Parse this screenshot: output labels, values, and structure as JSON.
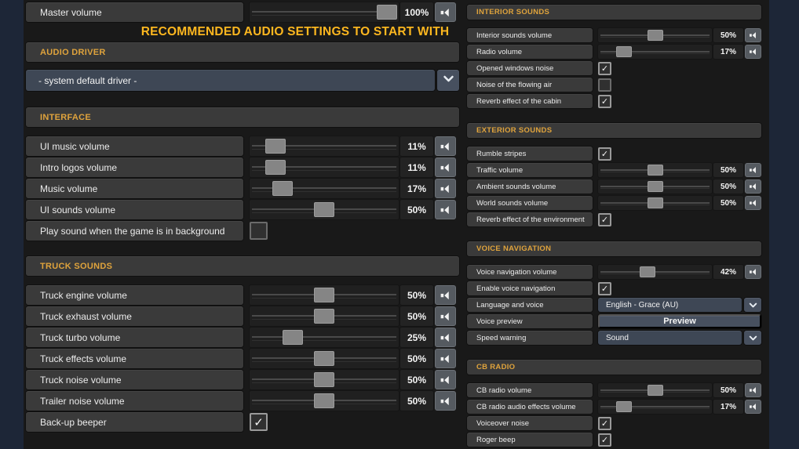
{
  "title": "RECOMMENDED AUDIO SETTINGS TO START WITH",
  "colors": {
    "accent_orange": "#dfa33c",
    "title_yellow": "#fdb71f",
    "panel_bg": "#191919",
    "side_strip": "#1d2637",
    "box_bg": "#3a3a3a",
    "dropdown_bg": "#3e4755",
    "slider_handle": "#858585"
  },
  "icons": {
    "mute": "speaker-icon",
    "dropdown": "chevron-down-icon",
    "checkmark": "✓"
  },
  "left": {
    "master_rows": [
      {
        "label": "Master volume",
        "type": "slider",
        "value": "100%",
        "percent": 100
      }
    ],
    "audio_driver": {
      "header": "AUDIO DRIVER",
      "selected": "- system default driver -"
    },
    "interface": {
      "header": "INTERFACE",
      "rows": [
        {
          "label": "UI music volume",
          "type": "slider",
          "value": "11%",
          "percent": 11
        },
        {
          "label": "Intro logos volume",
          "type": "slider",
          "value": "11%",
          "percent": 11
        },
        {
          "label": "Music volume",
          "type": "slider",
          "value": "17%",
          "percent": 17
        },
        {
          "label": "UI sounds volume",
          "type": "slider",
          "value": "50%",
          "percent": 50
        },
        {
          "label": "Play sound when the game is in background",
          "type": "checkbox",
          "checked": false
        }
      ]
    },
    "truck_sounds": {
      "header": "TRUCK SOUNDS",
      "rows": [
        {
          "label": "Truck engine volume",
          "type": "slider",
          "value": "50%",
          "percent": 50
        },
        {
          "label": "Truck exhaust volume",
          "type": "slider",
          "value": "50%",
          "percent": 50
        },
        {
          "label": "Truck turbo volume",
          "type": "slider",
          "value": "25%",
          "percent": 25
        },
        {
          "label": "Truck effects volume",
          "type": "slider",
          "value": "50%",
          "percent": 50
        },
        {
          "label": "Truck noise volume",
          "type": "slider",
          "value": "50%",
          "percent": 50
        },
        {
          "label": "Trailer noise volume",
          "type": "slider",
          "value": "50%",
          "percent": 50
        },
        {
          "label": "Back-up beeper",
          "type": "checkbox",
          "checked": true
        }
      ]
    }
  },
  "right": {
    "sections": [
      {
        "header": "INTERIOR SOUNDS",
        "rows": [
          {
            "label": "Interior sounds volume",
            "type": "slider",
            "value": "50%",
            "percent": 50
          },
          {
            "label": "Radio volume",
            "type": "slider",
            "value": "17%",
            "percent": 17
          },
          {
            "label": "Opened windows noise",
            "type": "checkbox",
            "checked": true
          },
          {
            "label": "Noise of the flowing air",
            "type": "checkbox",
            "checked": false
          },
          {
            "label": "Reverb effect of the cabin",
            "type": "checkbox",
            "checked": true
          }
        ]
      },
      {
        "header": "EXTERIOR SOUNDS",
        "rows": [
          {
            "label": "Rumble stripes",
            "type": "checkbox",
            "checked": true
          },
          {
            "label": "Traffic volume",
            "type": "slider",
            "value": "50%",
            "percent": 50
          },
          {
            "label": "Ambient sounds volume",
            "type": "slider",
            "value": "50%",
            "percent": 50
          },
          {
            "label": "World sounds volume",
            "type": "slider",
            "value": "50%",
            "percent": 50
          },
          {
            "label": "Reverb effect of the environment",
            "type": "checkbox",
            "checked": true
          }
        ]
      },
      {
        "header": "VOICE NAVIGATION",
        "rows": [
          {
            "label": "Voice navigation volume",
            "type": "slider",
            "value": "42%",
            "percent": 42
          },
          {
            "label": "Enable voice navigation",
            "type": "checkbox",
            "checked": true
          },
          {
            "label": "Language and voice",
            "type": "select",
            "value": "English - Grace (AU)"
          },
          {
            "label": "Voice preview",
            "type": "button",
            "value": "Preview"
          },
          {
            "label": "Speed warning",
            "type": "select",
            "value": "Sound"
          }
        ]
      },
      {
        "header": "CB RADIO",
        "rows": [
          {
            "label": "CB radio volume",
            "type": "slider",
            "value": "50%",
            "percent": 50
          },
          {
            "label": "CB radio audio effects volume",
            "type": "slider",
            "value": "17%",
            "percent": 17
          },
          {
            "label": "Voiceover noise",
            "type": "checkbox",
            "checked": true
          },
          {
            "label": "Roger beep",
            "type": "checkbox",
            "checked": true
          }
        ]
      }
    ]
  }
}
